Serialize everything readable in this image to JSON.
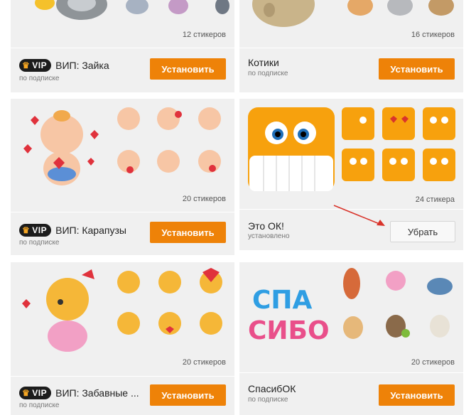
{
  "cards": [
    {
      "id": "zayka",
      "name": "ВИП: Зайка",
      "subtitle": "по подписке",
      "count": "12 стикеров",
      "button": "Установить",
      "vip": "VIP"
    },
    {
      "id": "kotiki",
      "name": "Котики",
      "subtitle": "по подписке",
      "count": "16 стикеров",
      "button": "Установить"
    },
    {
      "id": "karapuzy",
      "name": "ВИП: Карапузы",
      "subtitle": "по подписке",
      "count": "20 стикеров",
      "button": "Установить",
      "vip": "VIP"
    },
    {
      "id": "eto-ok",
      "name": "Это ОК!",
      "subtitle": "установлено",
      "count": "24 стикера",
      "button": "Убрать"
    },
    {
      "id": "zabavnye",
      "name": "ВИП: Забавные ...",
      "subtitle": "по подписке",
      "count": "20 стикеров",
      "button": "Установить",
      "vip": "VIP"
    },
    {
      "id": "spasibok",
      "name": "СпасибОК",
      "subtitle": "по подписке",
      "count": "",
      "button": "Установить"
    }
  ],
  "spasibo_count": "20 стикеров",
  "logo_text": {
    "line1": "СПА",
    "line2": "СИБО"
  },
  "colors": {
    "button": "#ee8208",
    "card": "#f0f0f0",
    "arrow": "#d9342b",
    "emoji": "#f7a10d"
  }
}
